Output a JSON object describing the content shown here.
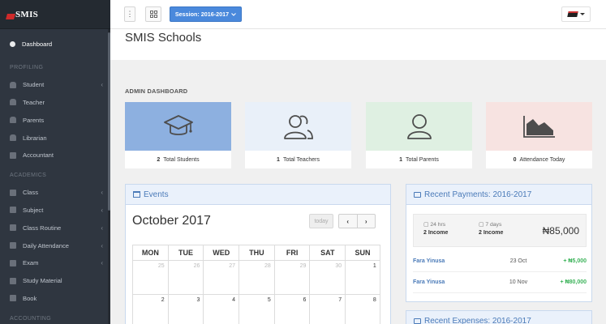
{
  "brand": {
    "logo_text": "SMIS"
  },
  "sidebar": {
    "dashboard": "Dashboard",
    "profiling_header": "PROFILING",
    "profiling": [
      "Student",
      "Teacher",
      "Parents",
      "Librarian",
      "Accountant"
    ],
    "academics_header": "ACADEMICS",
    "academics": [
      "Class",
      "Subject",
      "Class Routine",
      "Daily Attendance",
      "Exam",
      "Study Material",
      "Book"
    ],
    "accounting_header": "ACCOUNTING"
  },
  "topbar": {
    "menu_icon": "⋮",
    "session_label": "Session: 2016-2017"
  },
  "page": {
    "title": "SMIS Schools"
  },
  "admin_dashboard": {
    "label": "ADMIN DASHBOARD",
    "cards": [
      {
        "count": "2",
        "label": "Total Students",
        "icon": "graduation-cap-icon",
        "bg": "#8db0e0"
      },
      {
        "count": "1",
        "label": "Total Teachers",
        "icon": "users-icon",
        "bg": "#e9f0f9"
      },
      {
        "count": "1",
        "label": "Total Parents",
        "icon": "user-icon",
        "bg": "#dff0e2"
      },
      {
        "count": "0",
        "label": "Attendance Today",
        "icon": "area-chart-icon",
        "bg": "#f7e3e1"
      }
    ]
  },
  "events": {
    "title": "Events",
    "month": "October 2017",
    "today_label": "today",
    "prev": "‹",
    "next": "›",
    "days_of_week": [
      "MON",
      "TUE",
      "WED",
      "THU",
      "FRI",
      "SAT",
      "SUN"
    ],
    "weeks": [
      [
        "25",
        "26",
        "27",
        "28",
        "29",
        "30",
        "1"
      ],
      [
        "2",
        "3",
        "4",
        "5",
        "6",
        "7",
        "8"
      ]
    ]
  },
  "recent_payments": {
    "title": "Recent Payments: 2016-2017",
    "summary": {
      "col1_label": "24 hrs",
      "col1_value": "2 Income",
      "col2_label": "7 days",
      "col2_value": "2 Income",
      "total": "₦85,000"
    },
    "rows": [
      {
        "name": "Fara Yinusa",
        "date": "23 Oct",
        "amount": "+ ₦5,000"
      },
      {
        "name": "Fara Yinusa",
        "date": "10 Nov",
        "amount": "+ ₦80,000"
      }
    ]
  },
  "recent_expenses": {
    "title": "Recent Expenses: 2016-2017"
  }
}
